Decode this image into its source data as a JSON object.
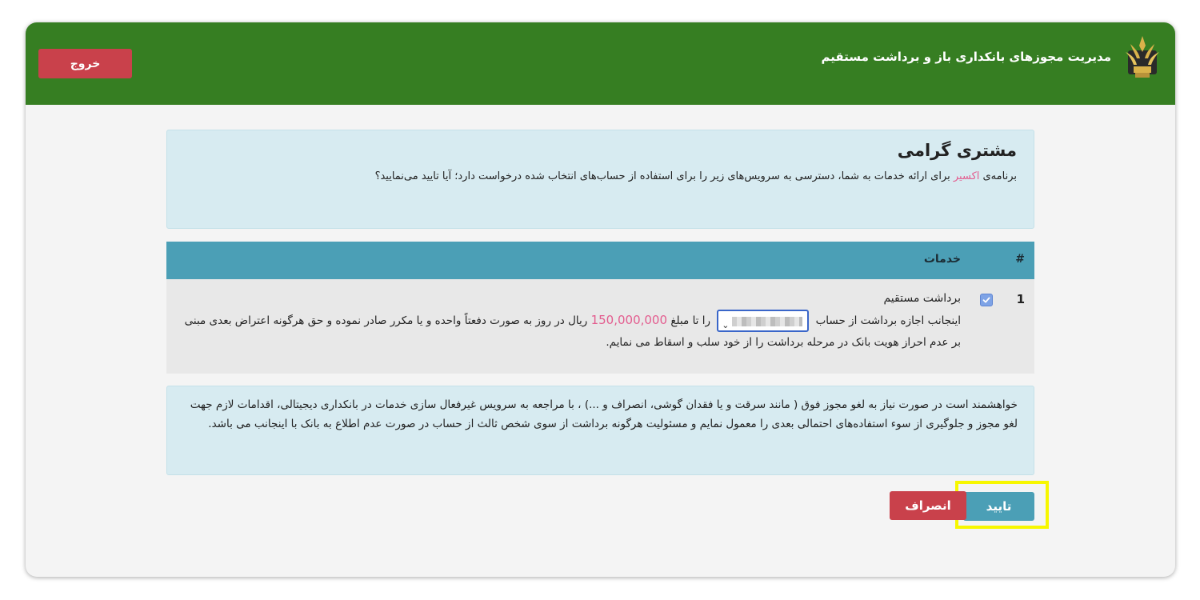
{
  "header": {
    "title": "مدیریت مجوزهای بانکداری باز و برداشت مستقیم",
    "logout_label": "خروج"
  },
  "intro": {
    "greeting": "مشتری گرامی",
    "text_before": "برنامه‌ی ",
    "app_name": "اکسیر",
    "text_after": " برای ارائه خدمات به شما، دسترسی به سرویس‌های زیر را برای استفاده از حساب‌های انتخاب شده درخواست دارد؛ آیا تایید می‌نمایید؟"
  },
  "table": {
    "col_hash": "#",
    "col_services": "خدمات",
    "rows": [
      {
        "num": "1",
        "checked": true,
        "title": "برداشت مستقیم",
        "desc_part1": "اینجانب اجازه برداشت از حساب",
        "desc_part2": "را تا مبلغ",
        "amount": "150,000,000",
        "desc_part3": "ریال در روز به صورت دفعتاً واحده و یا مکرر صادر نموده و حق هرگونه اعتراض بعدی مبنی بر عدم احراز هویت بانک در مرحله برداشت را از خود سلب و اسقاط می نمایم."
      }
    ]
  },
  "notice": {
    "text": "خواهشمند است در صورت نیاز به لغو مجوز فوق ( مانند سرقت و یا فقدان گوشی، انصراف و ...) ، با مراجعه به سرویس غیرفعال سازی خدمات در بانکداری دیجیتالی، اقدامات لازم جهت لغو مجوز و جلوگیری از سوء استفاده‌های احتمالی بعدی را معمول نمایم و مسئولیت هرگونه برداشت از سوی شخص ثالث از حساب در صورت عدم اطلاع به بانک با اینجانب می باشد."
  },
  "actions": {
    "confirm_label": "تایید",
    "cancel_label": "انصراف"
  },
  "colors": {
    "header_green": "#367e22",
    "danger": "#c9414b",
    "info": "#4b9fb6",
    "highlight": "#f7f700",
    "accent_pink": "#e35d8f"
  }
}
